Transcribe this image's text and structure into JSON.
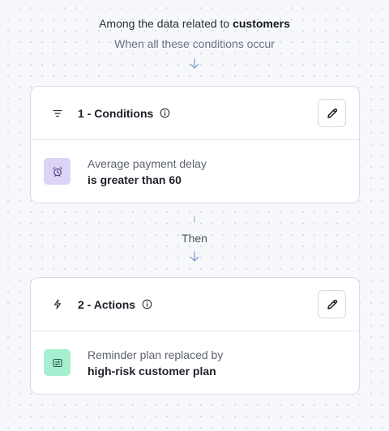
{
  "intro": {
    "prefix": "Among the data related to",
    "entity": "customers",
    "subtitle": "When all these conditions occur"
  },
  "conditions_card": {
    "title": "1 - Conditions",
    "header_icon": "filter-icon",
    "info_icon": "info-icon",
    "edit_icon": "pencil-icon",
    "condition": {
      "icon": "alarm-clock-icon",
      "label": "Average payment delay",
      "value": "is greater than 60"
    }
  },
  "connector": {
    "label": "Then"
  },
  "actions_card": {
    "title": "2 - Actions",
    "header_icon": "lightning-icon",
    "info_icon": "info-icon",
    "edit_icon": "pencil-icon",
    "action": {
      "icon": "replace-icon",
      "label": "Reminder plan replaced by",
      "value": "high-risk customer plan"
    }
  },
  "colors": {
    "accent_arrow": "#8aa3d6",
    "condition_tile": "#dcd3f5",
    "action_tile": "#a6efd0"
  }
}
